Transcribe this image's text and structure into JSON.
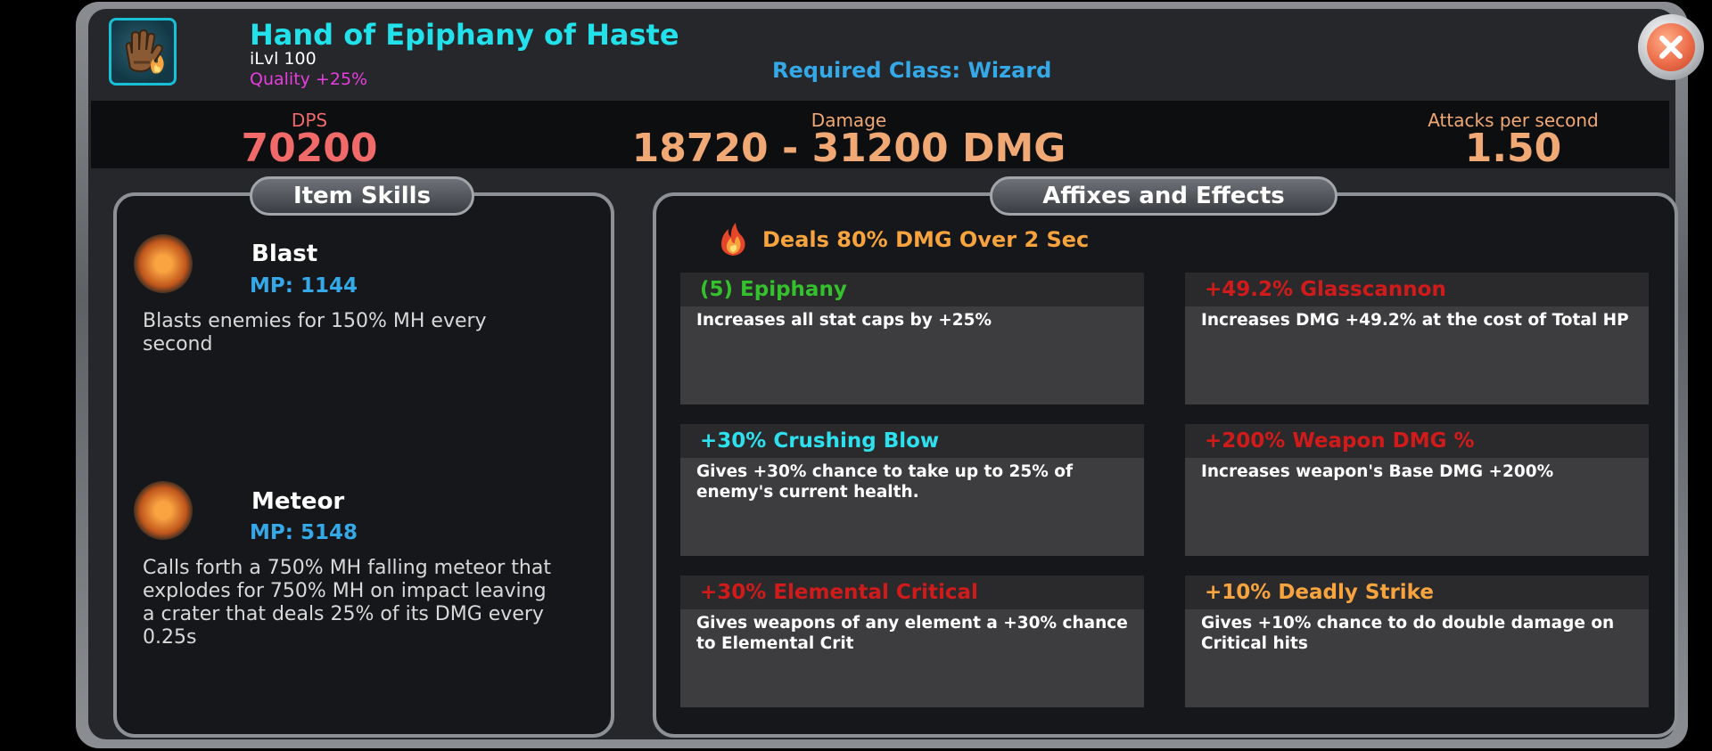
{
  "item": {
    "name": "Hand of Epiphany of Haste",
    "ilvl": "iLvl 100",
    "quality": "Quality +25%",
    "required_class": "Required Class: Wizard",
    "icon": "gauntlet-icon"
  },
  "stats": {
    "dps_label": "DPS",
    "dps_value": "70200",
    "damage_label": "Damage",
    "damage_value": "18720 - 31200 DMG",
    "aps_label": "Attacks per second",
    "aps_value": "1.50"
  },
  "skills": {
    "title": "Item Skills",
    "items": [
      {
        "name": "Blast",
        "mp": "MP: 1144",
        "desc": "Blasts enemies for 150% MH every second",
        "icon": "fire-blast-icon"
      },
      {
        "name": "Meteor",
        "mp": "MP: 5148",
        "desc": "Calls forth a 750% MH falling meteor that explodes for 750% MH on impact leaving a crater that deals 25% of its DMG every 0.25s",
        "icon": "meteor-icon"
      }
    ]
  },
  "affixes": {
    "title": "Affixes and Effects",
    "effect": "Deals 80% DMG Over 2 Sec",
    "effect_icon": "flame-icon",
    "items": [
      {
        "name": "(5) Epiphany",
        "desc": "Increases all stat caps by +25%",
        "color": "#34c12d"
      },
      {
        "name": "+49.2% Glasscannon",
        "desc": "Increases DMG +49.2% at the cost of Total HP",
        "color": "#d11b1b"
      },
      {
        "name": "+30% Crushing Blow",
        "desc": "Gives +30% chance to take up to 25% of enemy's current health.",
        "color": "#2ee0ee"
      },
      {
        "name": "+200% Weapon DMG %",
        "desc": "Increases weapon's Base DMG +200%",
        "color": "#d11b1b"
      },
      {
        "name": "+30% Elemental Critical",
        "desc": "Gives weapons of any element a +30% chance to Elemental Crit",
        "color": "#d11b1b"
      },
      {
        "name": "+10% Deadly Strike",
        "desc": "Gives +10% chance to do double damage on Critical hits",
        "color": "#f7a43e"
      }
    ]
  },
  "close": {
    "icon": "close-icon"
  }
}
